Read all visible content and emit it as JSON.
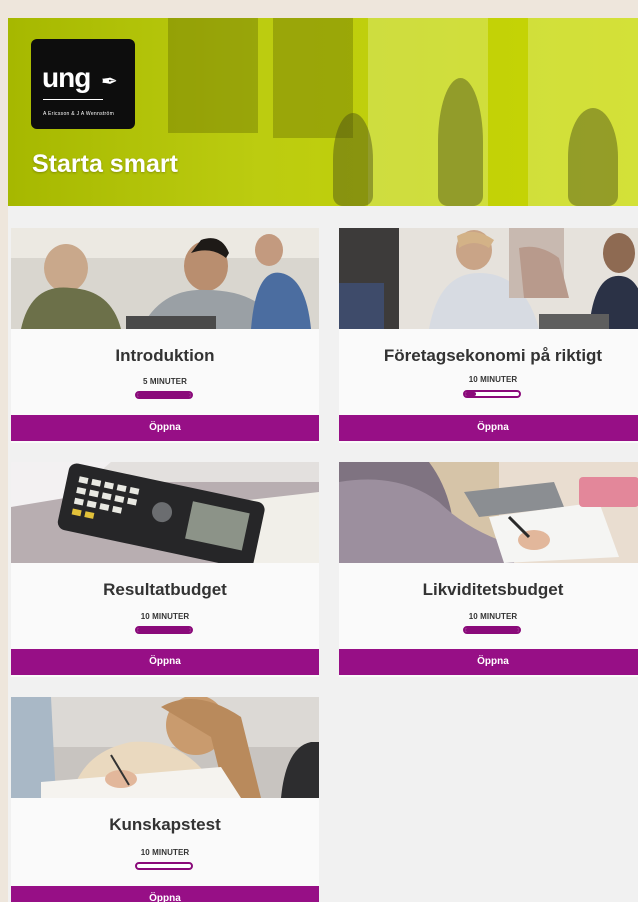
{
  "header": {
    "logo_text": "ung",
    "logo_tagline": "A Ericsson & J A Wennström",
    "title": "Starta smart",
    "background_color": "#bccc10"
  },
  "accent_color": "#970f86",
  "cards": [
    {
      "title": "Introduktion",
      "duration": "5 MINUTER",
      "progress": 1.0,
      "button": "Öppna"
    },
    {
      "title": "Företagsekonomi på riktigt",
      "duration": "10 MINUTER",
      "progress": 0.2,
      "button": "Öppna"
    },
    {
      "title": "Resultatbudget",
      "duration": "10 MINUTER",
      "progress": 1.0,
      "button": "Öppna"
    },
    {
      "title": "Likviditetsbudget",
      "duration": "10 MINUTER",
      "progress": 1.0,
      "button": "Öppna"
    },
    {
      "title": "Kunskapstest",
      "duration": "10 MINUTER",
      "progress": 0.0,
      "button": "Öppna"
    }
  ]
}
